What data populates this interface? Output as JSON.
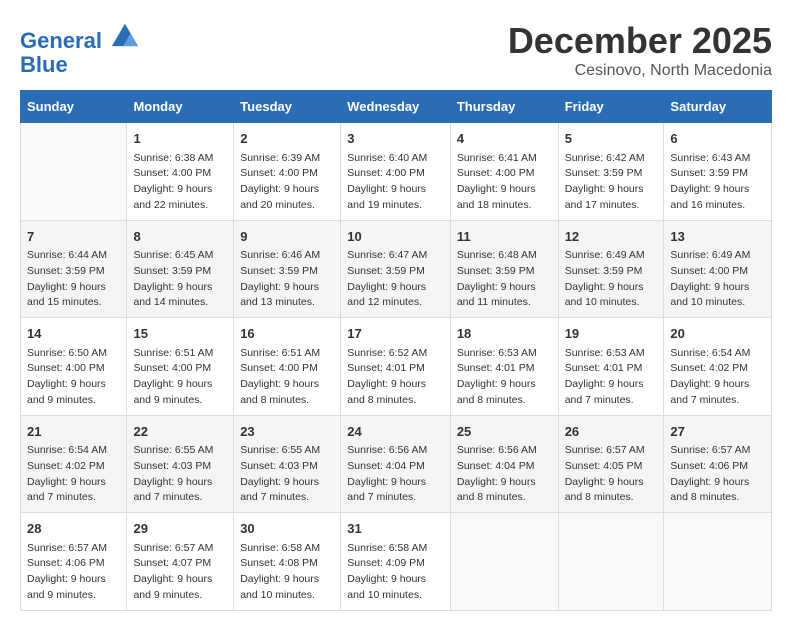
{
  "logo": {
    "line1": "General",
    "line2": "Blue"
  },
  "title": "December 2025",
  "location": "Cesinovo, North Macedonia",
  "header_days": [
    "Sunday",
    "Monday",
    "Tuesday",
    "Wednesday",
    "Thursday",
    "Friday",
    "Saturday"
  ],
  "weeks": [
    [
      {
        "day": "",
        "info": ""
      },
      {
        "day": "1",
        "info": "Sunrise: 6:38 AM\nSunset: 4:00 PM\nDaylight: 9 hours\nand 22 minutes."
      },
      {
        "day": "2",
        "info": "Sunrise: 6:39 AM\nSunset: 4:00 PM\nDaylight: 9 hours\nand 20 minutes."
      },
      {
        "day": "3",
        "info": "Sunrise: 6:40 AM\nSunset: 4:00 PM\nDaylight: 9 hours\nand 19 minutes."
      },
      {
        "day": "4",
        "info": "Sunrise: 6:41 AM\nSunset: 4:00 PM\nDaylight: 9 hours\nand 18 minutes."
      },
      {
        "day": "5",
        "info": "Sunrise: 6:42 AM\nSunset: 3:59 PM\nDaylight: 9 hours\nand 17 minutes."
      },
      {
        "day": "6",
        "info": "Sunrise: 6:43 AM\nSunset: 3:59 PM\nDaylight: 9 hours\nand 16 minutes."
      }
    ],
    [
      {
        "day": "7",
        "info": "Sunrise: 6:44 AM\nSunset: 3:59 PM\nDaylight: 9 hours\nand 15 minutes."
      },
      {
        "day": "8",
        "info": "Sunrise: 6:45 AM\nSunset: 3:59 PM\nDaylight: 9 hours\nand 14 minutes."
      },
      {
        "day": "9",
        "info": "Sunrise: 6:46 AM\nSunset: 3:59 PM\nDaylight: 9 hours\nand 13 minutes."
      },
      {
        "day": "10",
        "info": "Sunrise: 6:47 AM\nSunset: 3:59 PM\nDaylight: 9 hours\nand 12 minutes."
      },
      {
        "day": "11",
        "info": "Sunrise: 6:48 AM\nSunset: 3:59 PM\nDaylight: 9 hours\nand 11 minutes."
      },
      {
        "day": "12",
        "info": "Sunrise: 6:49 AM\nSunset: 3:59 PM\nDaylight: 9 hours\nand 10 minutes."
      },
      {
        "day": "13",
        "info": "Sunrise: 6:49 AM\nSunset: 4:00 PM\nDaylight: 9 hours\nand 10 minutes."
      }
    ],
    [
      {
        "day": "14",
        "info": "Sunrise: 6:50 AM\nSunset: 4:00 PM\nDaylight: 9 hours\nand 9 minutes."
      },
      {
        "day": "15",
        "info": "Sunrise: 6:51 AM\nSunset: 4:00 PM\nDaylight: 9 hours\nand 9 minutes."
      },
      {
        "day": "16",
        "info": "Sunrise: 6:51 AM\nSunset: 4:00 PM\nDaylight: 9 hours\nand 8 minutes."
      },
      {
        "day": "17",
        "info": "Sunrise: 6:52 AM\nSunset: 4:01 PM\nDaylight: 9 hours\nand 8 minutes."
      },
      {
        "day": "18",
        "info": "Sunrise: 6:53 AM\nSunset: 4:01 PM\nDaylight: 9 hours\nand 8 minutes."
      },
      {
        "day": "19",
        "info": "Sunrise: 6:53 AM\nSunset: 4:01 PM\nDaylight: 9 hours\nand 7 minutes."
      },
      {
        "day": "20",
        "info": "Sunrise: 6:54 AM\nSunset: 4:02 PM\nDaylight: 9 hours\nand 7 minutes."
      }
    ],
    [
      {
        "day": "21",
        "info": "Sunrise: 6:54 AM\nSunset: 4:02 PM\nDaylight: 9 hours\nand 7 minutes."
      },
      {
        "day": "22",
        "info": "Sunrise: 6:55 AM\nSunset: 4:03 PM\nDaylight: 9 hours\nand 7 minutes."
      },
      {
        "day": "23",
        "info": "Sunrise: 6:55 AM\nSunset: 4:03 PM\nDaylight: 9 hours\nand 7 minutes."
      },
      {
        "day": "24",
        "info": "Sunrise: 6:56 AM\nSunset: 4:04 PM\nDaylight: 9 hours\nand 7 minutes."
      },
      {
        "day": "25",
        "info": "Sunrise: 6:56 AM\nSunset: 4:04 PM\nDaylight: 9 hours\nand 8 minutes."
      },
      {
        "day": "26",
        "info": "Sunrise: 6:57 AM\nSunset: 4:05 PM\nDaylight: 9 hours\nand 8 minutes."
      },
      {
        "day": "27",
        "info": "Sunrise: 6:57 AM\nSunset: 4:06 PM\nDaylight: 9 hours\nand 8 minutes."
      }
    ],
    [
      {
        "day": "28",
        "info": "Sunrise: 6:57 AM\nSunset: 4:06 PM\nDaylight: 9 hours\nand 9 minutes."
      },
      {
        "day": "29",
        "info": "Sunrise: 6:57 AM\nSunset: 4:07 PM\nDaylight: 9 hours\nand 9 minutes."
      },
      {
        "day": "30",
        "info": "Sunrise: 6:58 AM\nSunset: 4:08 PM\nDaylight: 9 hours\nand 10 minutes."
      },
      {
        "day": "31",
        "info": "Sunrise: 6:58 AM\nSunset: 4:09 PM\nDaylight: 9 hours\nand 10 minutes."
      },
      {
        "day": "",
        "info": ""
      },
      {
        "day": "",
        "info": ""
      },
      {
        "day": "",
        "info": ""
      }
    ]
  ]
}
